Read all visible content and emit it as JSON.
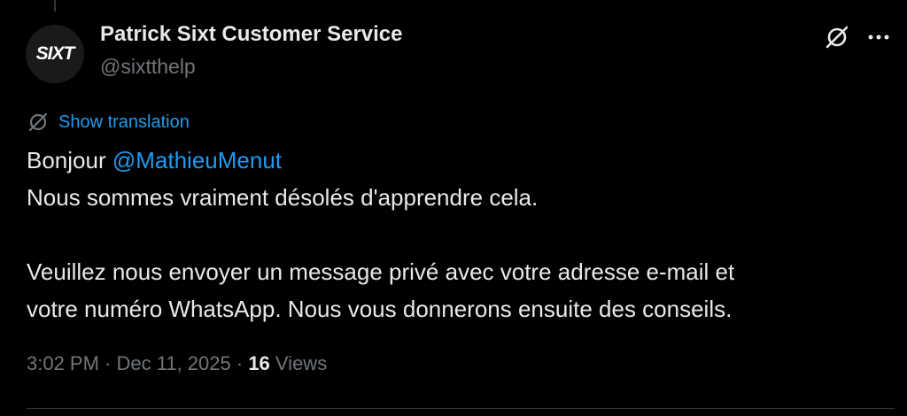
{
  "account": {
    "avatar_logo": "SIXT",
    "display_name": "Patrick Sixt Customer Service",
    "handle": "@sixtthelp"
  },
  "icons": {
    "grok": "grok-icon",
    "more": "more-icon",
    "translate": "translate-icon"
  },
  "translation": {
    "label": "Show translation"
  },
  "tweet": {
    "greeting": "Bonjour ",
    "mention": "@MathieuMenut",
    "line2": "Nous sommes vraiment désolés d'apprendre cela.",
    "line3": "",
    "line4": "Veuillez nous envoyer un message privé avec votre adresse e-mail et",
    "line5": "votre numéro WhatsApp. Nous vous donnerons ensuite des conseils."
  },
  "meta": {
    "time": "3:02 PM",
    "separator": " · ",
    "date": "Dec 11, 2025",
    "separator2": " · ",
    "views_count": "16",
    "views_label": " Views"
  },
  "colors": {
    "background": "#000000",
    "text": "#e7e9ea",
    "secondary": "#71767b",
    "accent": "#1d9bf0"
  }
}
